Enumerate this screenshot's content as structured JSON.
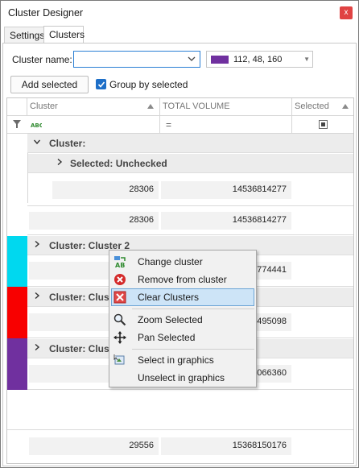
{
  "window": {
    "title": "Cluster Designer",
    "close_glyph": "x"
  },
  "tabs": [
    {
      "label": "Settings"
    },
    {
      "label": "Clusters"
    }
  ],
  "form": {
    "cluster_name_label": "Cluster name:",
    "cluster_name_value": "",
    "color_text": "112, 48, 160",
    "color_hex": "#70309f",
    "add_selected_label": "Add selected",
    "group_by_label": "Group by selected",
    "group_by_checked": true
  },
  "grid": {
    "columns": [
      {
        "label": "Cluster"
      },
      {
        "label": "TOTAL VOLUME"
      },
      {
        "label": "Selected"
      }
    ],
    "filter": {
      "text_icon": "abc-filter-icon",
      "eq_symbol": "="
    },
    "groups": {
      "cluster_empty": "Cluster:",
      "selected_unchecked": "Selected: Unchecked",
      "cluster_2": "Cluster: Cluster 2",
      "cluster_red_partial": "Cluster: Clust",
      "cluster_purple_partial": "Cluster: Clust"
    },
    "summaries": {
      "inner_count": "28306",
      "inner_volume": "14536814277",
      "outer_count": "28306",
      "outer_volume": "14536814277",
      "c2_volume_partial": "5774441",
      "red_volume_partial": "0495098",
      "purple_volume_partial": "4066360",
      "total_count": "29556",
      "total_volume": "15368150176"
    },
    "colors": {
      "cyan": "#00d8ef",
      "red": "#f80000",
      "purple": "#70309f"
    }
  },
  "context_menu": {
    "items": [
      {
        "label": "Change cluster",
        "icon": "change-cluster-icon"
      },
      {
        "label": "Remove from cluster",
        "icon": "remove-icon"
      },
      {
        "label": "Clear Clusters",
        "icon": "clear-icon",
        "highlighted": true
      },
      {
        "label": "Zoom Selected",
        "icon": "zoom-icon"
      },
      {
        "label": "Pan Selected",
        "icon": "pan-icon"
      },
      {
        "label": "Select in graphics",
        "icon": "select-graphics-icon"
      },
      {
        "label": "Unselect in graphics",
        "icon": "unselect-graphics-icon"
      }
    ]
  }
}
